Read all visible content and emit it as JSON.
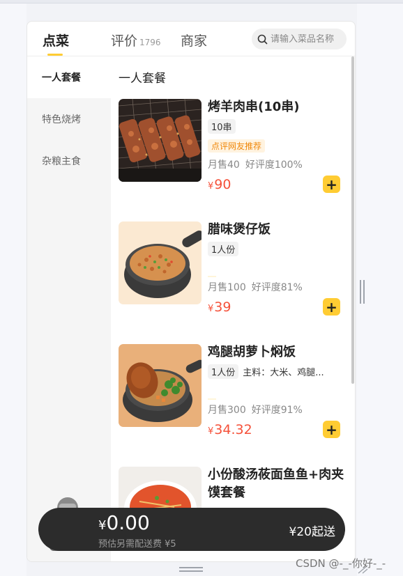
{
  "tabs": [
    {
      "label": "点菜",
      "count": ""
    },
    {
      "label": "评价",
      "count": "1796"
    },
    {
      "label": "商家",
      "count": ""
    }
  ],
  "search": {
    "placeholder": "请输入菜品名称"
  },
  "sidebar": {
    "items": [
      {
        "label": "一人套餐",
        "active": true
      },
      {
        "label": "特色烧烤",
        "active": false
      },
      {
        "label": "杂粮主食",
        "active": false
      }
    ]
  },
  "section": {
    "title": "一人套餐"
  },
  "currency": "¥",
  "add_symbol": "+",
  "dishes": [
    {
      "name": "烤羊肉串(10串)",
      "tags": [
        "10串"
      ],
      "desc": "",
      "badge": "点评网友推荐",
      "sales": "月售40",
      "rating": "好评度100%",
      "price": "90",
      "image_icon": "lamb-skewers-icon"
    },
    {
      "name": "腊味煲仔饭",
      "tags": [
        "1人份"
      ],
      "desc": "",
      "badge": "",
      "sales": "月售100",
      "rating": "好评度81%",
      "price": "39",
      "image_icon": "claypot-rice-icon"
    },
    {
      "name": "鸡腿胡萝卜焖饭",
      "tags": [
        "1人份"
      ],
      "desc": "主料：大米、鸡腿...",
      "badge": "",
      "sales": "月售300",
      "rating": "好评度91%",
      "price": "34.32",
      "image_icon": "chicken-leg-rice-icon"
    },
    {
      "name": "小份酸汤莜面鱼鱼+肉夹馍套餐",
      "tags": [],
      "desc": "",
      "badge": "",
      "sales": "",
      "rating": "",
      "price": "",
      "image_icon": "sour-soup-noodle-icon"
    }
  ],
  "cart": {
    "amount": "0.00",
    "delivery_note": "预估另需配送费 ¥5",
    "min_order": "¥20起送",
    "icon": "shopping-bag-icon"
  },
  "watermark": "CSDN @-_-你好-_-",
  "colors": {
    "accent": "#ffcc33",
    "price": "#f5513a",
    "badge_text": "#f0890c",
    "cart_bg": "#2c2c2c"
  }
}
